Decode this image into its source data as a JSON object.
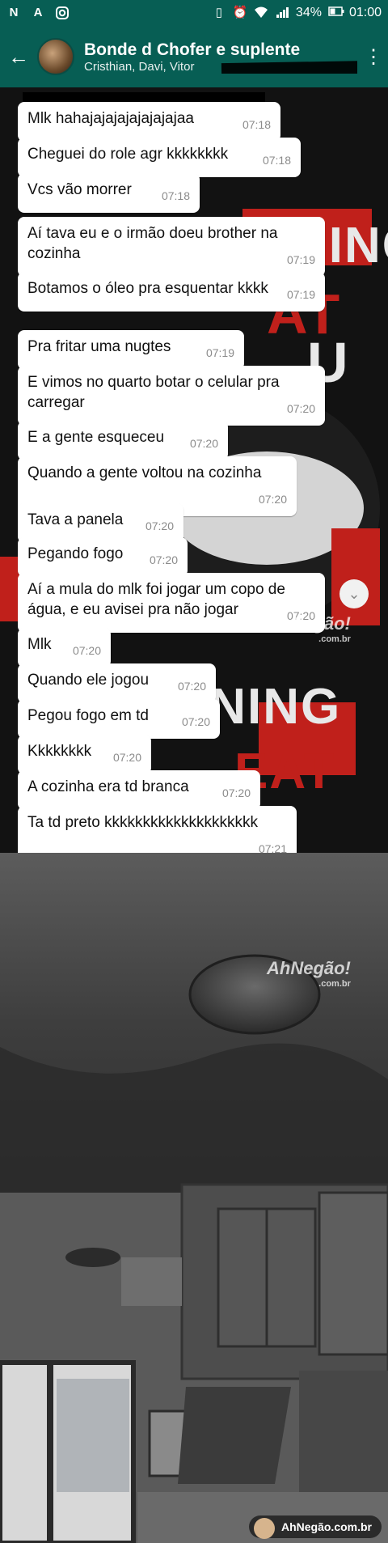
{
  "status_bar": {
    "left_icons": [
      "N",
      "A",
      "instagram-icon"
    ],
    "battery": "34%",
    "time": "01:00"
  },
  "header": {
    "title": "Bonde d Chofer e suplente",
    "members": "Cristhian, Davi, Vitor"
  },
  "wallpaper": {
    "texts": [
      "NING",
      "AT",
      "U",
      "INING",
      "EAT"
    ]
  },
  "messages": [
    {
      "text": "Mlk hahajajajajajajajajaa",
      "time": "07:18"
    },
    {
      "text": "Cheguei do role agr kkkkkkkk",
      "time": "07:18"
    },
    {
      "text": "Vcs vão morrer",
      "time": "07:18"
    },
    {
      "text": "Aí tava eu e o irmão doeu brother na cozinha",
      "time": "07:19"
    },
    {
      "text": "Botamos o óleo pra esquentar kkkk",
      "time": "07:19"
    },
    {
      "text": "Pra fritar uma nugtes",
      "time": "07:19"
    },
    {
      "text": "E vimos no quarto botar o celular pra carregar",
      "time": "07:20"
    },
    {
      "text": "E a gente esqueceu",
      "time": "07:20"
    },
    {
      "text": "Quando a gente voltou na cozinha",
      "time": "07:20"
    },
    {
      "text": "Tava a panela",
      "time": "07:20"
    },
    {
      "text": "Pegando fogo",
      "time": "07:20"
    },
    {
      "text": "Aí a mula do mlk foi jogar um copo de água, e eu avisei pra não jogar",
      "time": "07:20"
    },
    {
      "text": "Mlk",
      "time": "07:20"
    },
    {
      "text": "Quando ele jogou",
      "time": "07:20"
    },
    {
      "text": "Pegou fogo em td",
      "time": "07:20"
    },
    {
      "text": "Kkkkkkkk",
      "time": "07:20"
    },
    {
      "text": "A cozinha era td branca",
      "time": "07:20"
    },
    {
      "text": "Ta td preto kkkkkkkkkkkkkkkkkkkk",
      "time": "07:21"
    }
  ],
  "watermarks": {
    "brand": "AhNegão!",
    "domain": ".com.br",
    "footer": "AhNegão.com.br"
  }
}
